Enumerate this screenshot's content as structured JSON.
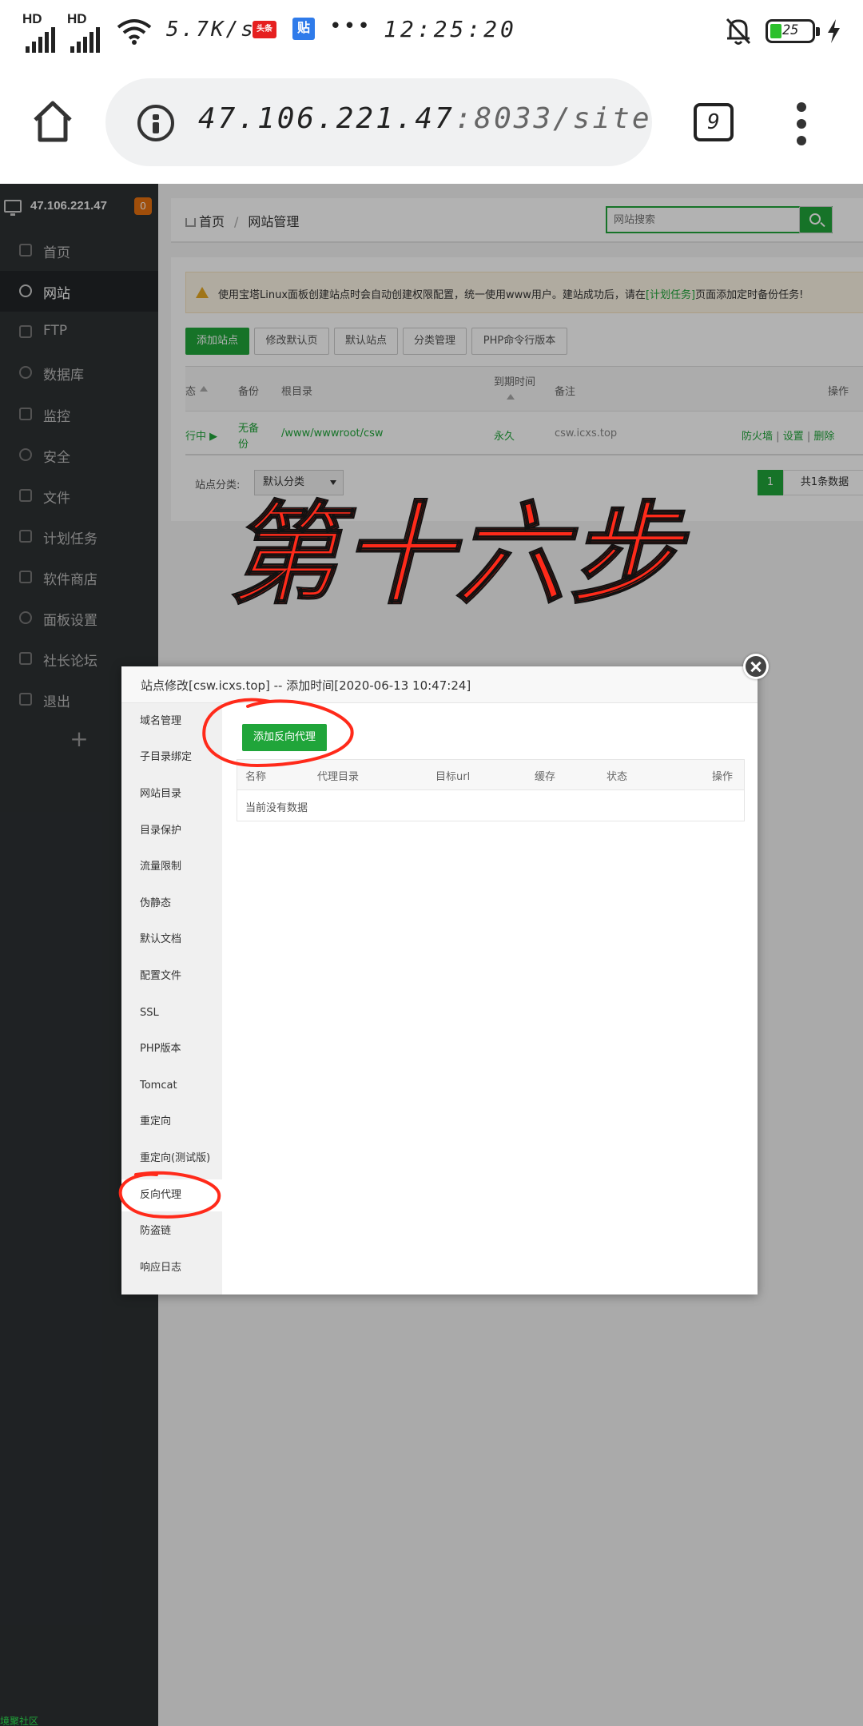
{
  "status_bar": {
    "net1": "HD",
    "net2": "HD",
    "speed": "5.7K/s",
    "app1": "头条",
    "app2": "贴",
    "more": "•••",
    "time": "12:25:20",
    "battery": "25"
  },
  "browser": {
    "url_host": "47.106.221.47",
    "url_rest": ":8033/site",
    "tab_count": "9"
  },
  "sidebar": {
    "host": "47.106.221.47",
    "badge": "0",
    "items": [
      {
        "label": "首页"
      },
      {
        "label": "网站"
      },
      {
        "label": "FTP"
      },
      {
        "label": "数据库"
      },
      {
        "label": "监控"
      },
      {
        "label": "安全"
      },
      {
        "label": "文件"
      },
      {
        "label": "计划任务"
      },
      {
        "label": "软件商店"
      },
      {
        "label": "面板设置"
      },
      {
        "label": "社长论坛"
      },
      {
        "label": "退出"
      }
    ],
    "add": "+",
    "footer": "境聚社区"
  },
  "breadcrumb": {
    "home": "首页",
    "sep": "/",
    "current": "网站管理"
  },
  "search": {
    "placeholder": "网站搜索"
  },
  "alert": {
    "pre": "使用宝塔Linux面板创建站点时会自动创建权限配置，统一使用www用户。建站成功后，请在",
    "link": "[计划任务]",
    "post": "页面添加定时备份任务!"
  },
  "toolbar_buttons": [
    "添加站点",
    "修改默认页",
    "默认站点",
    "分类管理",
    "PHP命令行版本"
  ],
  "site_table": {
    "headers": {
      "status": "态",
      "backup": "备份",
      "root": "根目录",
      "expire": "到期时间",
      "note": "备注",
      "ops": "操作"
    },
    "row": {
      "status": "行中 ▶",
      "backup_l1": "无备",
      "backup_l2": "份",
      "root": "/www/wwwroot/csw",
      "expire": "永久",
      "note": "csw.icxs.top",
      "op1": "防火墙",
      "op2": "设置",
      "op3": "删除",
      "sep": "|"
    }
  },
  "table_footer": {
    "category_label": "站点分类:",
    "category_value": "默认分类",
    "page": "1",
    "total": "共1条数据"
  },
  "annotation": {
    "step": "第十六步"
  },
  "modal": {
    "title": "站点修改[csw.icxs.top] -- 添加时间[2020-06-13 10:47:24]",
    "menu": [
      "域名管理",
      "子目录绑定",
      "网站目录",
      "目录保护",
      "流量限制",
      "伪静态",
      "默认文档",
      "配置文件",
      "SSL",
      "PHP版本",
      "Tomcat",
      "重定向",
      "重定向(测试版)",
      "反向代理",
      "防盗链",
      "响应日志"
    ],
    "add_button": "添加反向代理",
    "headers": {
      "name": "名称",
      "dir": "代理目录",
      "url": "目标url",
      "cache": "缓存",
      "state": "状态",
      "ops": "操作"
    },
    "empty": "当前没有数据"
  },
  "colors": {
    "brand_green": "#20a53a",
    "sidebar_bg": "#2d3133",
    "annotation_red": "#ff2a1a"
  }
}
